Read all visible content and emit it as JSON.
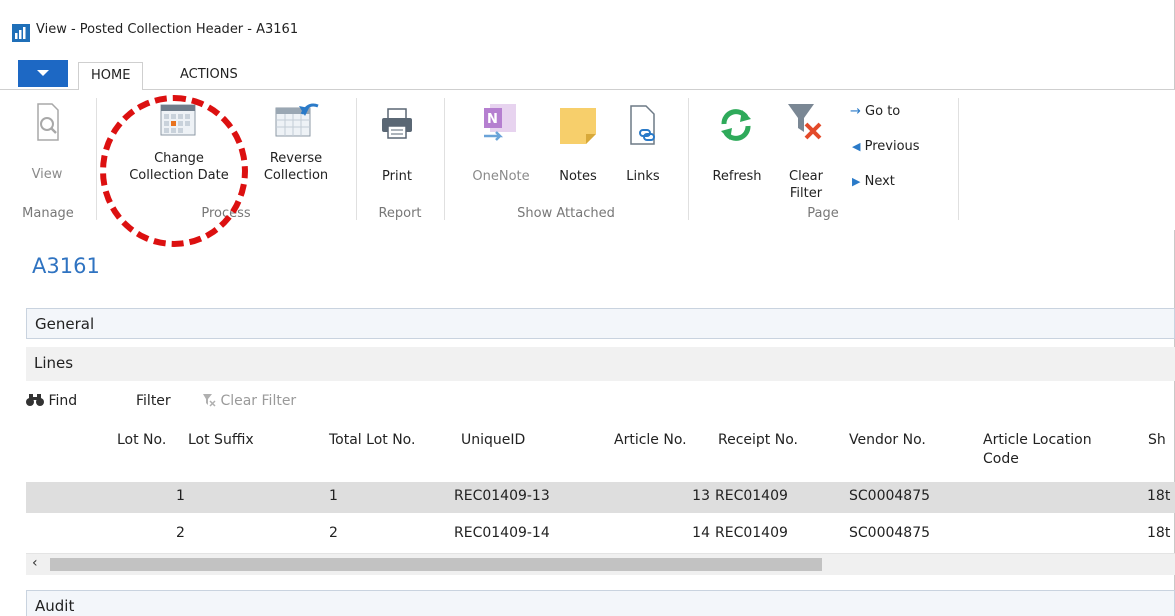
{
  "window": {
    "title": "View - Posted Collection Header - A3161"
  },
  "ribbon": {
    "tabs": [
      {
        "label": "HOME"
      },
      {
        "label": "ACTIONS"
      }
    ],
    "groups": {
      "manage": "Manage",
      "process": "Process",
      "report": "Report",
      "show_attached": "Show Attached",
      "page": "Page"
    },
    "buttons": {
      "view": "View",
      "change_collection_date_1": "Change",
      "change_collection_date_2": "Collection Date",
      "reverse_collection_1": "Reverse",
      "reverse_collection_2": "Collection",
      "print": "Print",
      "onenote": "OneNote",
      "notes": "Notes",
      "links": "Links",
      "refresh": "Refresh",
      "clear_filter_1": "Clear",
      "clear_filter_2": "Filter",
      "go_to": "Go to",
      "previous": "Previous",
      "next": "Next"
    }
  },
  "page": {
    "title": "A3161"
  },
  "sections": {
    "general": "General",
    "lines": "Lines",
    "audit": "Audit"
  },
  "lines_toolbar": {
    "find": "Find",
    "filter": "Filter",
    "clear_filter": "Clear Filter"
  },
  "lines_table": {
    "columns": {
      "lot_no": "Lot No.",
      "lot_suffix": "Lot Suffix",
      "total_lot_no": "Total Lot No.",
      "unique_id": "UniqueID",
      "article_no": "Article No.",
      "receipt_no": "Receipt No.",
      "vendor_no": "Vendor No.",
      "article_location_code_1": "Article Location",
      "article_location_code_2": "Code",
      "sh_cut": "Sh"
    },
    "rows": [
      {
        "lot_no": "1",
        "total_lot_no": "1",
        "unique_id": "REC01409-13",
        "article_no": "13",
        "receipt_no": "REC01409",
        "vendor_no": "SC0004875",
        "sh": "18t"
      },
      {
        "lot_no": "2",
        "total_lot_no": "2",
        "unique_id": "REC01409-14",
        "article_no": "14",
        "receipt_no": "REC01409",
        "vendor_no": "SC0004875",
        "sh": "18t"
      }
    ]
  },
  "colors": {
    "accent": "#1d68c4",
    "title_blue": "#2f73c1",
    "annotation_red": "#dc1010"
  }
}
